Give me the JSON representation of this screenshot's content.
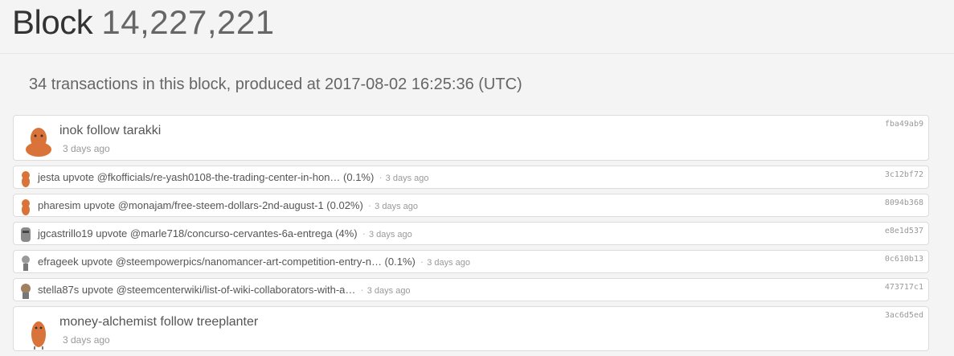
{
  "header": {
    "block_label": "Block",
    "block_number": "14,227,221",
    "subtitle": "34 transactions in this block, produced at 2017-08-02 16:25:36 (UTC)"
  },
  "transactions": [
    {
      "text": "inok follow tarakki",
      "time": "3 days ago",
      "hash": "fba49ab9"
    },
    {
      "text": "jesta upvote @fkofficials/re-yash0108-the-trading-center-in-hon… (0.1%)",
      "time": "3 days ago",
      "hash": "3c12bf72"
    },
    {
      "text": "pharesim upvote @monajam/free-steem-dollars-2nd-august-1 (0.02%)",
      "time": "3 days ago",
      "hash": "8094b368"
    },
    {
      "text": "jgcastrillo19 upvote @marle718/concurso-cervantes-6a-entrega (4%)",
      "time": "3 days ago",
      "hash": "e8e1d537"
    },
    {
      "text": "efrageek upvote @steempowerpics/nanomancer-art-competition-entry-n… (0.1%)",
      "time": "3 days ago",
      "hash": "0c610b13"
    },
    {
      "text": "stella87s upvote @steemcenterwiki/list-of-wiki-collaborators-with-a…",
      "time": "3 days ago",
      "hash": "473717c1"
    },
    {
      "text": "money-alchemist follow treeplanter",
      "time": "3 days ago",
      "hash": "3ac6d5ed"
    }
  ],
  "colors": {
    "avatar_orange": "#d9733a",
    "avatar_gray": "#8a8a8a"
  }
}
